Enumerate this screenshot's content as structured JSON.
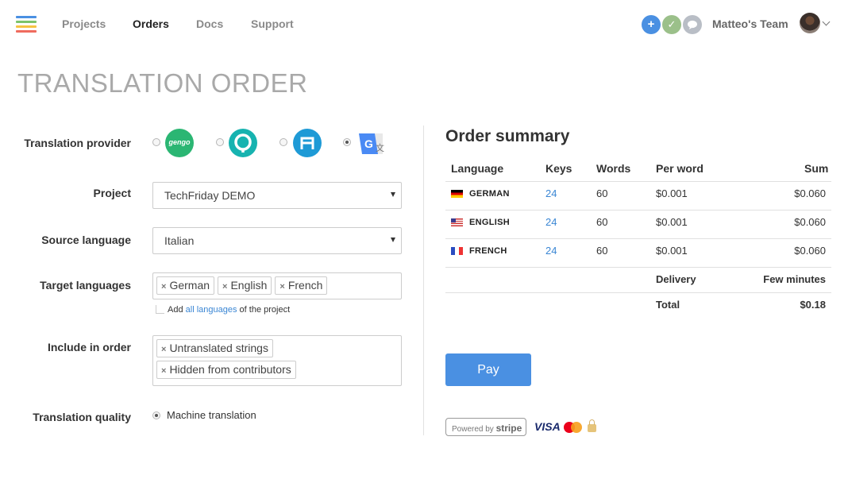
{
  "nav": {
    "links": [
      "Projects",
      "Orders",
      "Docs",
      "Support"
    ],
    "active": "Orders",
    "icons": [
      "plus-icon",
      "check-icon",
      "chat-icon"
    ],
    "icon_glyphs": [
      "+",
      "✓",
      ""
    ],
    "icon_colors": [
      "#4a90e2",
      "#9bc08a",
      "#b9bec6"
    ],
    "team": "Matteo's Team"
  },
  "page_title": "TRANSLATION ORDER",
  "form": {
    "provider": {
      "label": "Translation provider",
      "options": [
        {
          "name": "gengo",
          "text": "gengo",
          "color": "#2bb673",
          "selected": false
        },
        {
          "name": "q-provider",
          "text": "",
          "color": "#17b3b0",
          "selected": false
        },
        {
          "name": "fr-provider",
          "text": "",
          "color": "#1e9ad6",
          "selected": false
        },
        {
          "name": "google-translate",
          "text": "G",
          "color": "#4a8af4",
          "selected": true
        }
      ]
    },
    "project": {
      "label": "Project",
      "value": "TechFriday DEMO"
    },
    "source_language": {
      "label": "Source language",
      "value": "Italian"
    },
    "target_languages": {
      "label": "Target languages",
      "tags": [
        "German",
        "English",
        "French"
      ],
      "hint_prefix": "Add",
      "hint_link": "all languages",
      "hint_suffix": "of the project"
    },
    "include_in_order": {
      "label": "Include in order",
      "tags": [
        "Untranslated strings",
        "Hidden from contributors"
      ]
    },
    "quality": {
      "label": "Translation quality",
      "option": "Machine translation"
    }
  },
  "summary": {
    "title": "Order summary",
    "headers": [
      "Language",
      "Keys",
      "Words",
      "Per word",
      "Sum"
    ],
    "rows": [
      {
        "language": "GERMAN",
        "keys": "24",
        "words": "60",
        "per_word": "$0.001",
        "sum": "$0.060",
        "flag": "de"
      },
      {
        "language": "ENGLISH",
        "keys": "24",
        "words": "60",
        "per_word": "$0.001",
        "sum": "$0.060",
        "flag": "us"
      },
      {
        "language": "FRENCH",
        "keys": "24",
        "words": "60",
        "per_word": "$0.001",
        "sum": "$0.060",
        "flag": "fr"
      }
    ],
    "delivery_label": "Delivery",
    "delivery_value": "Few minutes",
    "total_label": "Total",
    "total_value": "$0.18",
    "pay_label": "Pay",
    "stripe_prefix": "Powered by",
    "stripe_brand": "stripe",
    "visa": "VISA"
  }
}
